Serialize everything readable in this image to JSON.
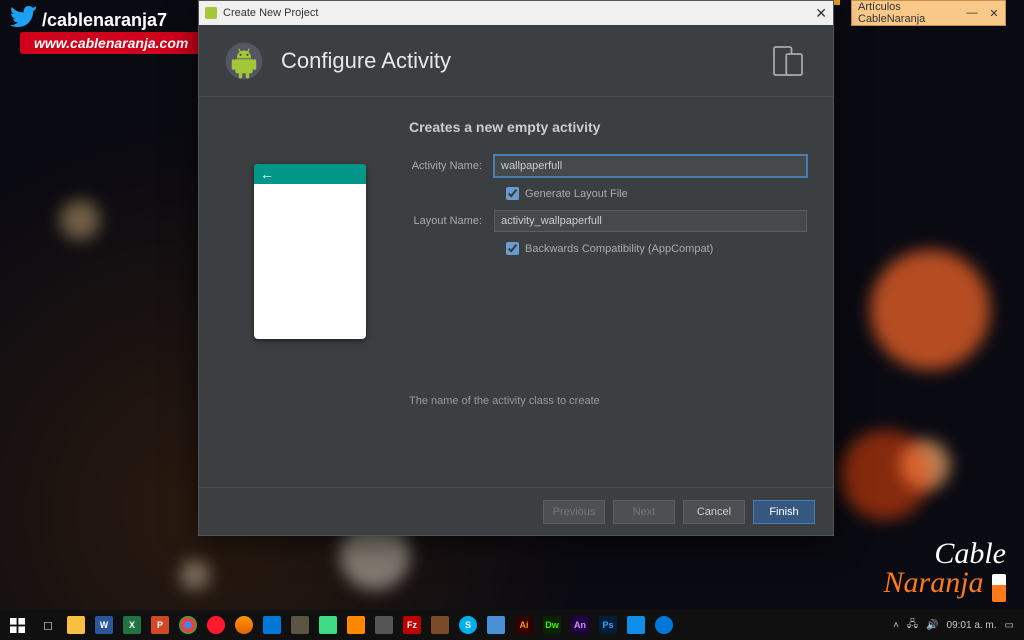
{
  "desktop": {
    "twitter_handle": "/cablenaranja7",
    "website_url": "www.cablenaranja.com",
    "brand_line1": "Cable",
    "brand_line2": "Naranja"
  },
  "mini_window": {
    "title": "Artículos CableNaranja",
    "minimize": "—",
    "close": "✕"
  },
  "dialog": {
    "window_title": "Create New Project",
    "header_title": "Configure Activity",
    "section_title": "Creates a new empty activity",
    "activity_name_label": "Activity Name:",
    "activity_name_value": "wallpaperfull",
    "generate_layout_label": "Generate Layout File",
    "generate_layout_checked": true,
    "layout_name_label": "Layout Name:",
    "layout_name_value": "activity_wallpaperfull",
    "backwards_compat_label": "Backwards Compatibility (AppCompat)",
    "backwards_compat_checked": true,
    "hint": "The name of the activity class to create",
    "buttons": {
      "previous": "Previous",
      "next": "Next",
      "cancel": "Cancel",
      "finish": "Finish"
    }
  },
  "taskbar": {
    "time": "09:01 a. m."
  },
  "icons": {
    "back_arrow": "←",
    "chevron_up": "˄"
  }
}
